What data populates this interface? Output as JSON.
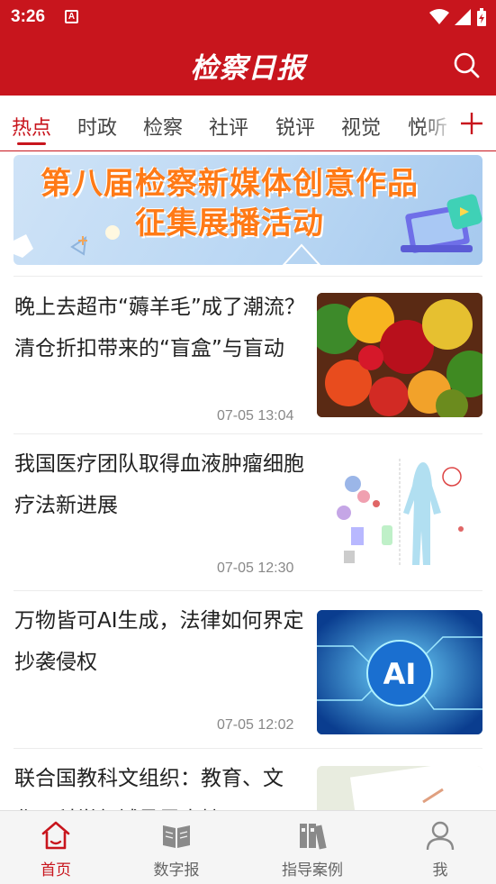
{
  "status_bar": {
    "time": "3:26",
    "notification_glyph": "A"
  },
  "header": {
    "logo": "检察日报",
    "search_icon": "search-icon"
  },
  "tabs": [
    {
      "label": "热点",
      "active": true
    },
    {
      "label": "时政",
      "active": false
    },
    {
      "label": "检察",
      "active": false
    },
    {
      "label": "社评",
      "active": false
    },
    {
      "label": "锐评",
      "active": false
    },
    {
      "label": "视觉",
      "active": false
    },
    {
      "label": "悦听",
      "active": false
    }
  ],
  "banner": {
    "line1": "第八届检察新媒体创意作品",
    "line2": "征集展播活动"
  },
  "news": [
    {
      "title": "晚上去超市“薅羊毛”成了潮流？清仓折扣带来的“盲盒”与盲动",
      "time": "07-05 13:04",
      "thumb": "fruits-vegetables-photo"
    },
    {
      "title": "我国医疗团队取得血液肿瘤细胞疗法新进展",
      "time": "07-05 12:30",
      "thumb": "car-t-diagram"
    },
    {
      "title": "万物皆可AI生成，法律如何界定抄袭侵权",
      "time": "07-05 12:02",
      "thumb": "ai-circuit-image",
      "thumb_text": "AI"
    },
    {
      "title": "联合国教科文组织：教育、文化、科学领域亟需支持",
      "time": "",
      "thumb": "paper-photo"
    }
  ],
  "bottom_nav": [
    {
      "label": "首页",
      "icon": "home-icon",
      "active": true
    },
    {
      "label": "数字报",
      "icon": "book-icon",
      "active": false
    },
    {
      "label": "指导案例",
      "icon": "binders-icon",
      "active": false
    },
    {
      "label": "我",
      "icon": "person-icon",
      "active": false
    }
  ],
  "colors": {
    "brand_red": "#c8151d",
    "banner_text": "#ff7a16",
    "muted": "#888888"
  }
}
